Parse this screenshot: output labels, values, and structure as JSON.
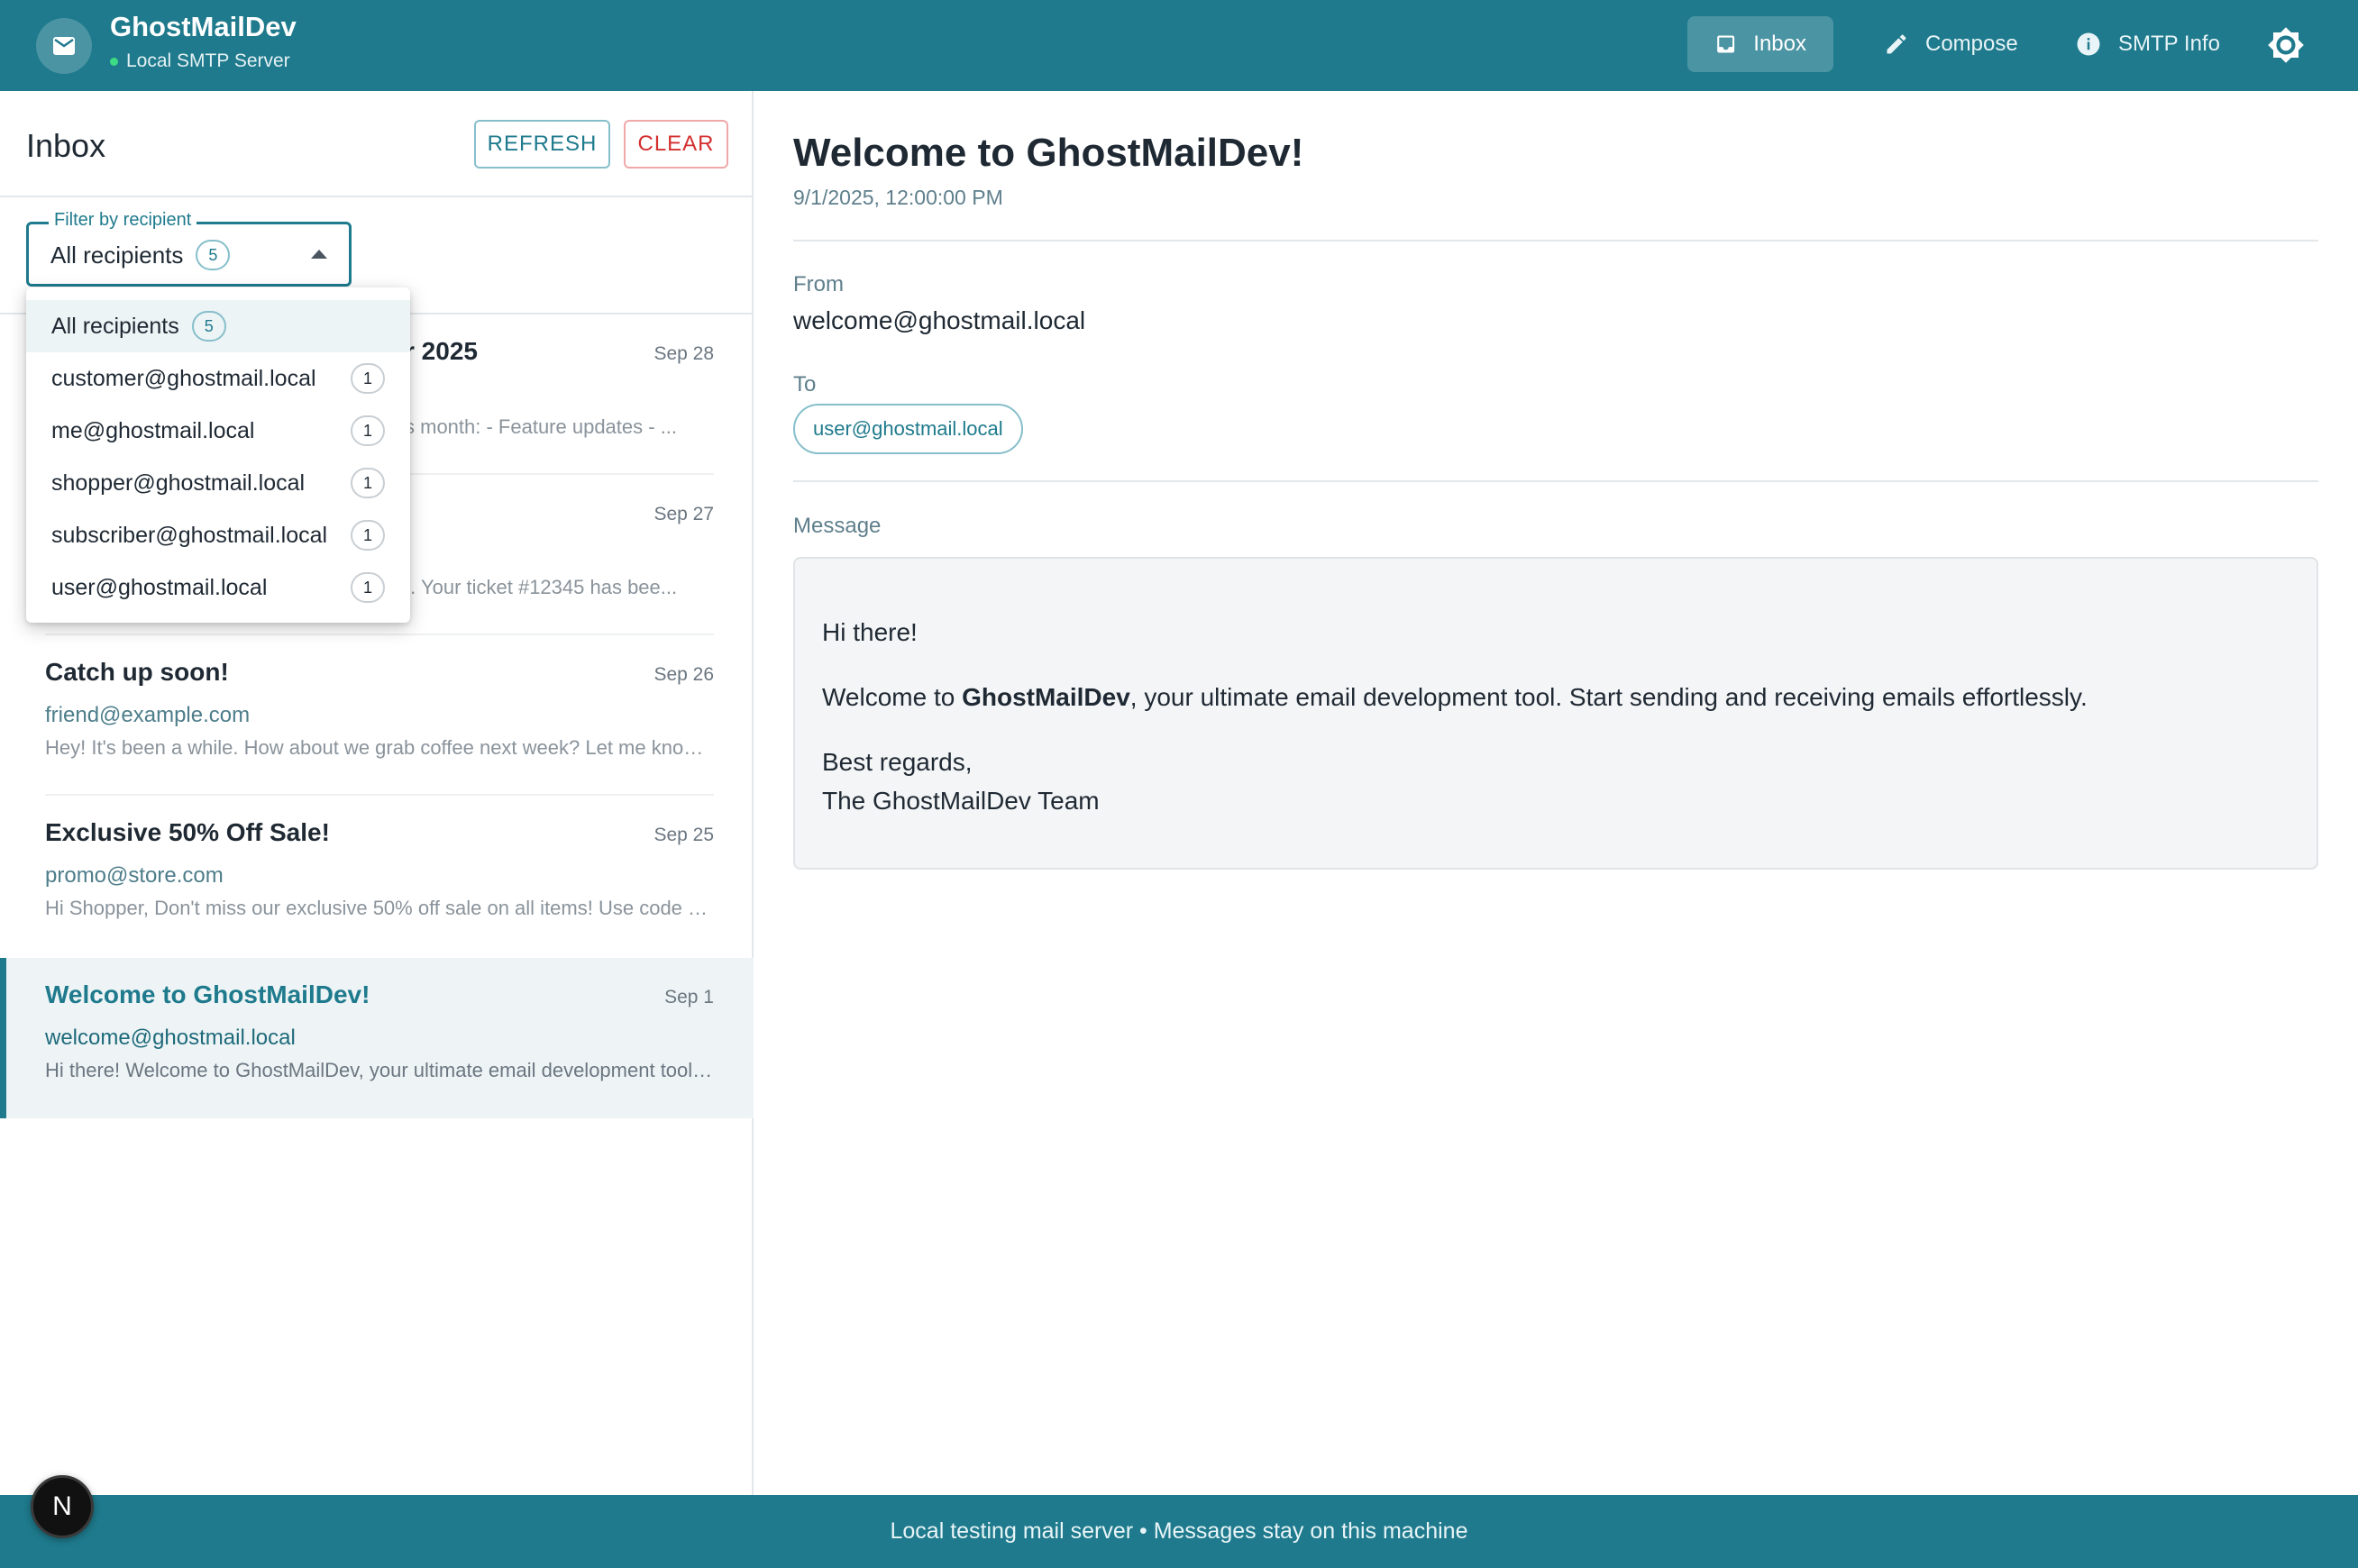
{
  "app": {
    "title": "GhostMailDev",
    "subtitle": "Local SMTP Server",
    "logo_icon": "mail-icon"
  },
  "nav": {
    "inbox": "Inbox",
    "compose": "Compose",
    "smtp_info": "SMTP Info",
    "active": "Inbox"
  },
  "inbox": {
    "title": "Inbox",
    "refresh_label": "REFRESH",
    "clear_label": "CLEAR"
  },
  "filter": {
    "label": "Filter by recipient",
    "selected": "All recipients",
    "selected_count": "5",
    "options": [
      {
        "label": "All recipients",
        "count": "5"
      },
      {
        "label": "customer@ghostmail.local",
        "count": "1"
      },
      {
        "label": "me@ghostmail.local",
        "count": "1"
      },
      {
        "label": "shopper@ghostmail.local",
        "count": "1"
      },
      {
        "label": "subscriber@ghostmail.local",
        "count": "1"
      },
      {
        "label": "user@ghostmail.local",
        "count": "1"
      }
    ]
  },
  "messages": [
    {
      "subject": "r 2025",
      "date": "Sep 28",
      "sender": "",
      "preview": "s month: - Feature updates - ..."
    },
    {
      "subject": "",
      "date": "Sep 27",
      "sender": "",
      "preview": "t. Your ticket #12345 has bee..."
    },
    {
      "subject": "Catch up soon!",
      "date": "Sep 26",
      "sender": "friend@example.com",
      "preview": "Hey! It's been a while. How about we grab coffee next week? Let me know what works for you."
    },
    {
      "subject": "Exclusive 50% Off Sale!",
      "date": "Sep 25",
      "sender": "promo@store.com",
      "preview": "Hi Shopper, Don't miss our exclusive 50% off sale on all items! Use code SAVE50 at checkout."
    },
    {
      "subject": "Welcome to GhostMailDev!",
      "date": "Sep 1",
      "sender": "welcome@ghostmail.local",
      "preview": "Hi there! Welcome to GhostMailDev, your ultimate email development tool. Start sending and receiving emails effortlessly."
    }
  ],
  "detail": {
    "subject": "Welcome to GhostMailDev!",
    "datetime": "9/1/2025, 12:00:00 PM",
    "from_label": "From",
    "from": "welcome@ghostmail.local",
    "to_label": "To",
    "to": "user@ghostmail.local",
    "message_label": "Message",
    "body": {
      "greeting": "Hi there!",
      "line_prefix": "Welcome to ",
      "line_bold": "GhostMailDev",
      "line_suffix": ", your ultimate email development tool. Start sending and receiving emails effortlessly.",
      "signoff": "Best regards,",
      "signature": "The GhostMailDev Team"
    }
  },
  "footer": {
    "text": "Local testing mail server • Messages stay on this machine"
  },
  "dev_badge": "N",
  "colors": {
    "brand": "#1e7a8c",
    "clear_red": "#d32f2f",
    "status_green": "#3ddc84"
  }
}
